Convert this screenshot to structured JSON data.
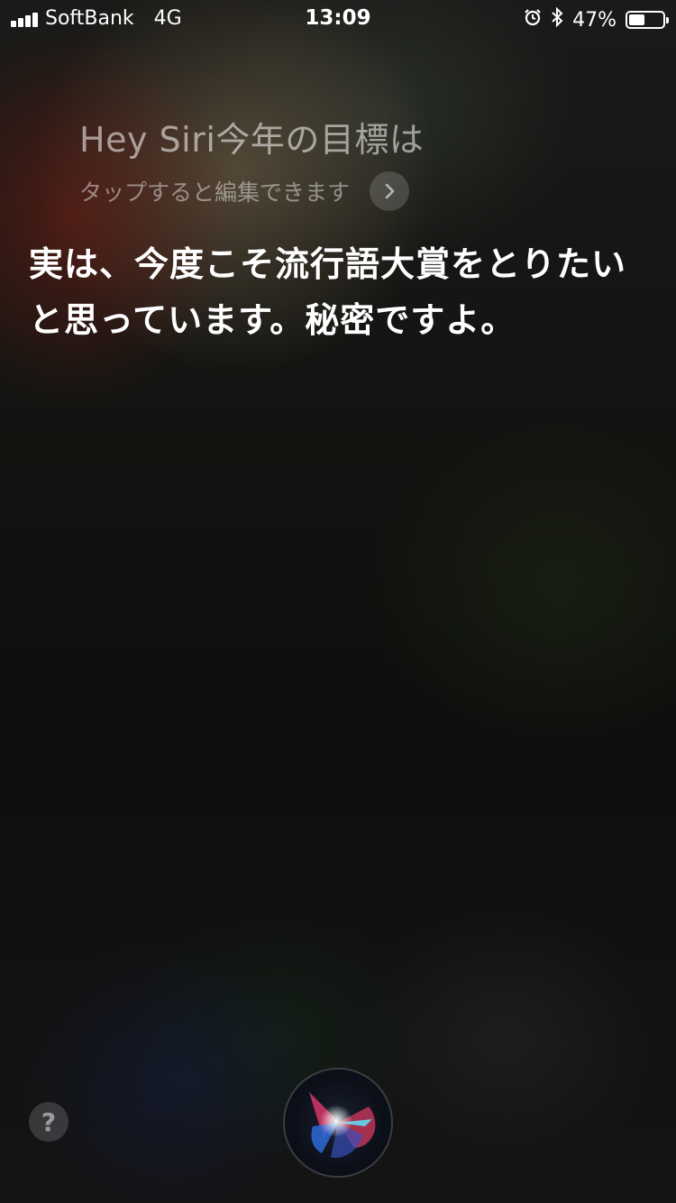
{
  "status_bar": {
    "carrier": "SoftBank",
    "network": "4G",
    "time": "13:09",
    "battery_percent": "47%",
    "battery_level": 0.47,
    "icons": [
      "signal-icon",
      "alarm-icon",
      "bluetooth-icon",
      "battery-icon"
    ]
  },
  "siri": {
    "query": "Hey Siri今年の目標は",
    "edit_hint": "タップすると編集できます",
    "response": "実は、今度こそ流行語大賞をとりたいと思っています。秘密ですよ。"
  },
  "controls": {
    "help_label": "?"
  },
  "colors": {
    "text_primary": "#ffffff",
    "text_secondary": "rgba(255,255,255,0.55)"
  }
}
